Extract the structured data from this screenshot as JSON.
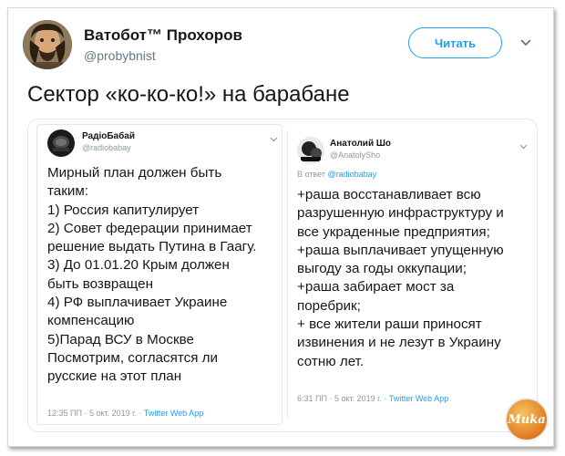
{
  "main_tweet": {
    "author_name": "Ватобот™ Прохоров",
    "author_handle": "@probybnist",
    "follow_button": "Читать",
    "text": "Сектор «ко-ко-ко!» на барабане"
  },
  "left_tweet": {
    "author_name": "РадіоБабай",
    "author_handle": "@radiobabay",
    "lines": [
      "Мирный план должен быть",
      "таким:",
      "1) Россия капитулирует",
      "2) Совет федерации принимает",
      "решение выдать Путина в Гаагу.",
      "3) До 01.01.20 Крым должен",
      "быть возвращен",
      "4) РФ выплачивает Украине",
      "компенсацию",
      "5)Парад ВСУ в Москве",
      "Посмотрим, согласятся ли",
      "русские на этот план"
    ],
    "timestamp": "12:35 ПП · 5 окт. 2019 г. · ",
    "source": "Twitter Web App"
  },
  "right_tweet": {
    "author_name": "Анатолий Шо",
    "author_handle": "@AnatolySho",
    "reply_prefix": "В ответ ",
    "reply_to": "@radiobabay",
    "lines": [
      "+раша восстанавливает всю",
      "разрушенную инфраструктуру и",
      "все украденные предприятия;",
      "+раша выплачивает упущенную",
      "выгоду за годы оккупации;",
      "+раша  забирает мост  за",
      "поребрик;",
      "+ все жители раши приносят",
      "извинения и не лезут в Украину",
      "сотню лет."
    ],
    "timestamp": "6:31 ПП · 5 окт. 2019 г. · ",
    "source": "Twitter Web App"
  },
  "watermark": "Muka",
  "colors": {
    "accent": "#1da1f2",
    "text": "#14171a",
    "secondary": "#657786",
    "logo": "#e8892c"
  }
}
